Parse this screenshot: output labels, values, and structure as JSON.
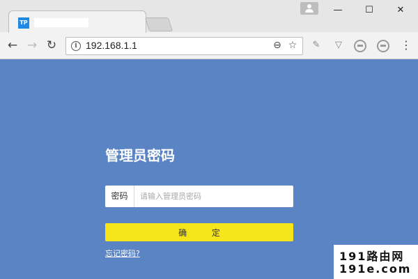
{
  "browser": {
    "tab_favicon": "TP",
    "url": "192.168.1.1",
    "window_controls": {
      "minimize": "—",
      "maximize": "☐",
      "close": "✕"
    },
    "nav": {
      "back": "←",
      "forward": "→",
      "reload": "↻"
    },
    "omnibox_icons": {
      "zoom": "⊖",
      "bookmark": "☆"
    },
    "menu": "⋮"
  },
  "login": {
    "title": "管理员密码",
    "password_label": "密码",
    "password_placeholder": "请输入管理员密码",
    "password_value": "",
    "confirm_label": "确 定",
    "forgot_link": "忘记密码?"
  },
  "watermark": {
    "line1": "191路由网",
    "line2": "191e.com"
  },
  "colors": {
    "background": "#5b84c4",
    "confirm_button": "#f7e51c"
  }
}
